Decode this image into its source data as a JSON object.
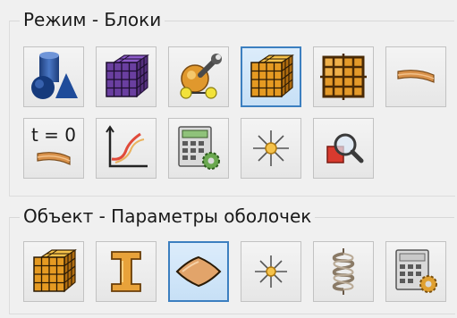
{
  "groups": {
    "mode": {
      "title": "Режим - Блоки",
      "buttons": [
        {
          "icon": "geometry-shapes-icon",
          "active": false
        },
        {
          "icon": "purple-mesh-cube-icon",
          "active": false
        },
        {
          "icon": "wrench-tools-icon",
          "active": false
        },
        {
          "icon": "orange-block-cube-icon",
          "active": true
        },
        {
          "icon": "grid-block-icon",
          "active": false
        },
        {
          "icon": "shell-plate-icon",
          "active": false
        },
        {
          "icon": "initial-state-t0-icon",
          "active": false,
          "label": "t = 0"
        },
        {
          "icon": "curve-graph-icon",
          "active": false
        },
        {
          "icon": "calculator-settings-icon",
          "active": false
        },
        {
          "icon": "point-star-icon",
          "active": false
        },
        {
          "icon": "zoom-inspect-icon",
          "active": false
        }
      ]
    },
    "object": {
      "title": "Объект - Параметры оболочек",
      "buttons": [
        {
          "icon": "orange-block-cube-icon",
          "active": false
        },
        {
          "icon": "beam-i-profile-icon",
          "active": false
        },
        {
          "icon": "shell-diamond-icon",
          "active": true
        },
        {
          "icon": "point-star-icon",
          "active": false
        },
        {
          "icon": "spring-coil-icon",
          "active": false
        },
        {
          "icon": "calculator-settings-icon",
          "active": false
        }
      ]
    }
  }
}
